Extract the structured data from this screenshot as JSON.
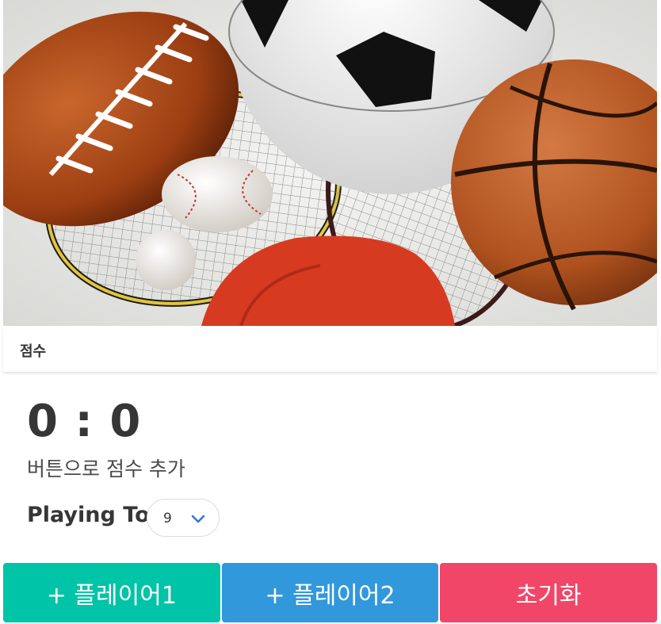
{
  "card": {
    "header_title": "점수"
  },
  "score": {
    "display": "0 : 0",
    "hint": "버튼으로 점수 추가"
  },
  "playing_to": {
    "label": "Playing To",
    "selected_value": "9"
  },
  "footer": {
    "player1_label": "+ 플레이어1",
    "player2_label": "+ 플레이어2",
    "reset_label": "초기화"
  },
  "colors": {
    "player1": "#00c4a7",
    "player2": "#3298dc",
    "reset": "#f14668",
    "text": "#363636"
  },
  "icons": {
    "select_arrow": "chevron-down-icon"
  }
}
